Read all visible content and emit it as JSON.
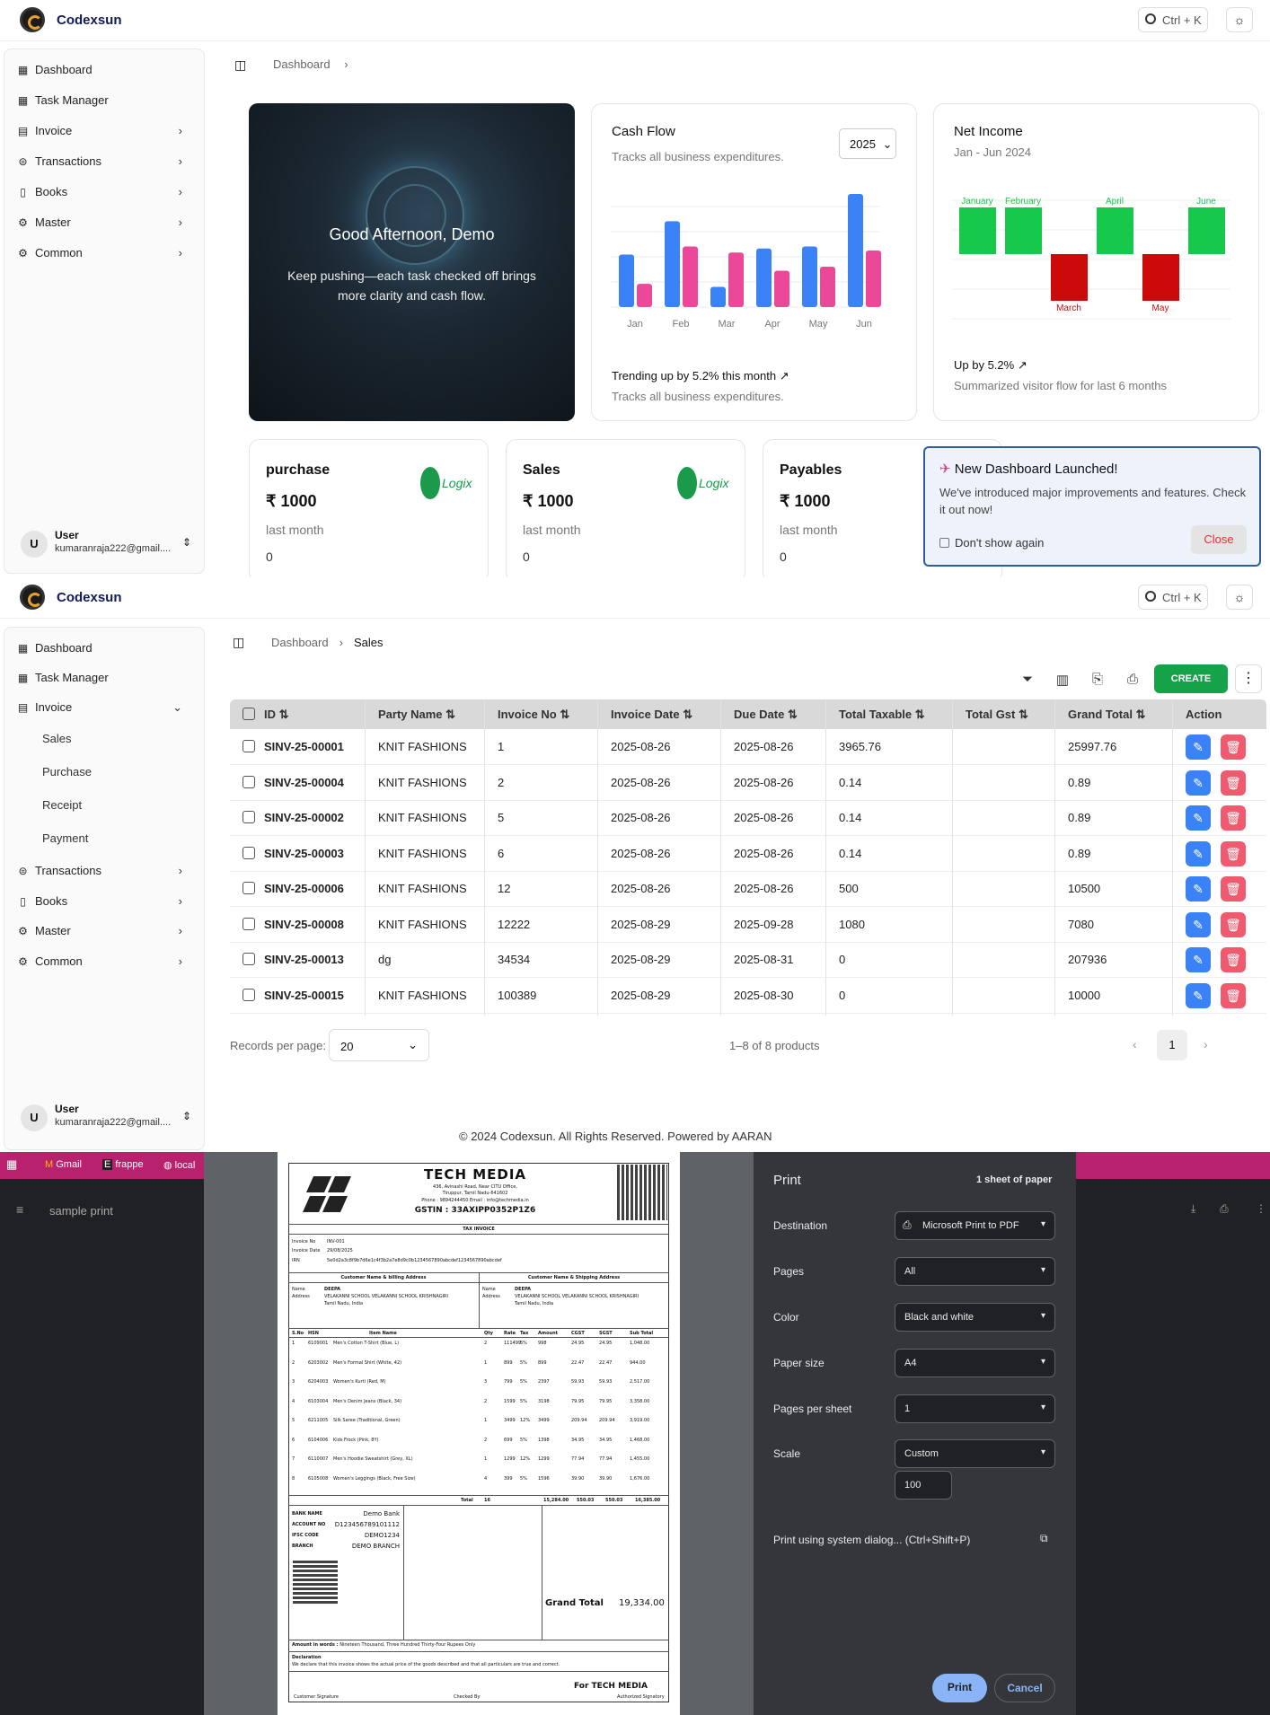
{
  "app": {
    "brand": "Codexsun",
    "search_shortcut": "Ctrl + K"
  },
  "sidebar": {
    "items": [
      {
        "label": "Dashboard",
        "icon": "grid-icon"
      },
      {
        "label": "Task Manager",
        "icon": "grid-icon"
      },
      {
        "label": "Invoice",
        "icon": "document-icon"
      },
      {
        "label": "Transactions",
        "icon": "currency-icon"
      },
      {
        "label": "Books",
        "icon": "book-icon"
      },
      {
        "label": "Master",
        "icon": "gear-icon"
      },
      {
        "label": "Common",
        "icon": "gear-icon"
      }
    ],
    "invoice_sub": [
      "Sales",
      "Purchase",
      "Receipt",
      "Payment"
    ],
    "user": {
      "initial": "U",
      "name": "User",
      "email": "kumaranraja222@gmail...."
    }
  },
  "dashboard": {
    "breadcrumb": "Dashboard",
    "hero": {
      "greeting": "Good Afternoon, Demo",
      "message": "Keep pushing—each task checked off brings more clarity and cash flow."
    },
    "cashflow": {
      "title": "Cash Flow",
      "subtitle": "Tracks all business expenditures.",
      "year": "2025",
      "trend": "Trending up by 5.2% this month",
      "footer": "Tracks all business expenditures."
    },
    "netincome": {
      "title": "Net Income",
      "subtitle": "Jan - Jun 2024",
      "trend": "Up by 5.2%",
      "footer": "Summarized visitor flow for last 6 months"
    },
    "stats": [
      {
        "title": "purchase",
        "value": "₹ 1000",
        "label": "last month",
        "count": "0",
        "logo": "Logix"
      },
      {
        "title": "Sales",
        "value": "₹ 1000",
        "label": "last month",
        "count": "0",
        "logo": "Logix"
      },
      {
        "title": "Payables",
        "value": "₹ 1000",
        "label": "last month",
        "count": "0"
      }
    ],
    "toast": {
      "title": "New Dashboard Launched!",
      "body": "We've introduced major improvements and features. Check it out now!",
      "checkbox": "Don't show again",
      "close": "Close"
    }
  },
  "chart_data": [
    {
      "type": "bar",
      "title": "Cash Flow",
      "categories": [
        "Jan",
        "Feb",
        "Mar",
        "Apr",
        "May",
        "Jun"
      ],
      "series": [
        {
          "values": [
            52,
            85,
            20,
            58,
            60,
            112
          ]
        },
        {
          "values": [
            23,
            60,
            54,
            36,
            40,
            56
          ]
        }
      ],
      "colors": [
        "#3b82f6",
        "#ec4899"
      ],
      "ylim": [
        0,
        120
      ]
    },
    {
      "type": "bar",
      "title": "Net Income",
      "categories": [
        "January",
        "February",
        "April",
        "June",
        "March",
        "May"
      ],
      "bars": [
        {
          "label": "January",
          "value": 1
        },
        {
          "label": "February",
          "value": 1
        },
        {
          "label": "March",
          "value": -1
        },
        {
          "label": "April",
          "value": 1
        },
        {
          "label": "May",
          "value": -1
        },
        {
          "label": "June",
          "value": 1
        }
      ],
      "colors": {
        "positive": "#16c94a",
        "negative": "#cc0a0a"
      }
    }
  ],
  "sales": {
    "breadcrumb": [
      "Dashboard",
      "Sales"
    ],
    "create": "CREATE",
    "columns": [
      "ID",
      "Party Name",
      "Invoice No",
      "Invoice Date",
      "Due Date",
      "Total Taxable",
      "Total Gst",
      "Grand Total",
      "Action"
    ],
    "rows": [
      [
        "SINV-25-00001",
        "KNIT FASHIONS",
        "1",
        "2025-08-26",
        "2025-08-26",
        "3965.76",
        "",
        "25997.76"
      ],
      [
        "SINV-25-00004",
        "KNIT FASHIONS",
        "2",
        "2025-08-26",
        "2025-08-26",
        "0.14",
        "",
        "0.89"
      ],
      [
        "SINV-25-00002",
        "KNIT FASHIONS",
        "5",
        "2025-08-26",
        "2025-08-26",
        "0.14",
        "",
        "0.89"
      ],
      [
        "SINV-25-00003",
        "KNIT FASHIONS",
        "6",
        "2025-08-26",
        "2025-08-26",
        "0.14",
        "",
        "0.89"
      ],
      [
        "SINV-25-00006",
        "KNIT FASHIONS",
        "12",
        "2025-08-26",
        "2025-08-26",
        "500",
        "",
        "10500"
      ],
      [
        "SINV-25-00008",
        "KNIT FASHIONS",
        "12222",
        "2025-08-29",
        "2025-09-28",
        "1080",
        "",
        "7080"
      ],
      [
        "SINV-25-00013",
        "dg",
        "34534",
        "2025-08-29",
        "2025-08-31",
        "0",
        "",
        "207936"
      ],
      [
        "SINV-25-00015",
        "KNIT FASHIONS",
        "100389",
        "2025-08-29",
        "2025-08-30",
        "0",
        "",
        "10000"
      ]
    ],
    "records_label": "Records per page:",
    "records_value": "20",
    "summary": "1–8 of 8 products",
    "page": "1",
    "footer": "© 2024 Codexsun. All Rights Reserved. Powered by AARAN"
  },
  "browser": {
    "bookmarks": [
      "Gmail",
      "frappe",
      "local"
    ],
    "tab_title": "sample print"
  },
  "invoice": {
    "company": "TECH MEDIA",
    "address": "436, Avinashi Road, Near CITU Office,",
    "city": "Tiruppur, Tamil Nadu-641602",
    "contact": "Phone : 9894244450 Email : info@techmedia.in",
    "gstin": "GSTIN : 33AXIPP0352P1Z6",
    "doc_title": "TAX INVOICE",
    "invoice_no": "INV-001",
    "invoice_date": "29/08/2025",
    "irn": "5e0d2a3c8f9b7d6e1c4f3b2a7e8d9c0b1234567890abcdef1234567890abcdef",
    "billing_header": "Customer Name & billing Address",
    "shipping_header": "Customer Name & Shipping Address",
    "customer": "DEEPA",
    "cust_address": "VELAKANNI SCHOOL VELAKANNI SCHOOL KRISHNAGIRI",
    "cust_state": "Tamil Nadu, India",
    "item_headers": [
      "S.No",
      "HSN",
      "Item Name",
      "Qty",
      "Rate",
      "Tax",
      "Amount",
      "CGST",
      "SGST",
      "Sub Total"
    ],
    "items": [
      [
        "1",
        "6109001",
        "Men's Cotton T-Shirt (Blue, L)",
        "2",
        "111499",
        "5%",
        "998",
        "24.95",
        "24.95",
        "1,048.00"
      ],
      [
        "2",
        "6203002",
        "Men's Formal Shirt (White, 42)",
        "1",
        "899",
        "5%",
        "899",
        "22.47",
        "22.47",
        "944.00"
      ],
      [
        "3",
        "6204003",
        "Women's Kurti (Red, M)",
        "3",
        "799",
        "5%",
        "2397",
        "59.93",
        "59.93",
        "2,517.00"
      ],
      [
        "4",
        "6103004",
        "Men's Denim Jeans (Black, 34)",
        "2",
        "1599",
        "5%",
        "3198",
        "79.95",
        "79.95",
        "3,358.00"
      ],
      [
        "5",
        "6211005",
        "Silk Saree (Traditional, Green)",
        "1",
        "3499",
        "12%",
        "3499",
        "209.94",
        "209.94",
        "3,919.00"
      ],
      [
        "6",
        "6104006",
        "Kids Frock (Pink, 8Y)",
        "2",
        "699",
        "5%",
        "1398",
        "34.95",
        "34.95",
        "1,468.00"
      ],
      [
        "7",
        "6110007",
        "Men's Hoodie Sweatshirt (Grey, XL)",
        "1",
        "1299",
        "12%",
        "1299",
        "77.94",
        "77.94",
        "1,455.00"
      ],
      [
        "8",
        "6105008",
        "Women's Leggings (Black, Free Size)",
        "4",
        "399",
        "5%",
        "1596",
        "39.90",
        "39.90",
        "1,676.00"
      ]
    ],
    "total_qty": "16",
    "total_amount": "15,284.00",
    "total_cgst": "550.03",
    "total_sgst": "550.03",
    "total_sub": "16,385.00",
    "bank_name": "Demo Bank",
    "account_no": "D123456789101112",
    "ifsc": "DEMO1234",
    "branch": "DEMO BRANCH",
    "grand_total_label": "Grand Total",
    "grand_total": "19,334.00",
    "words": "Nineteen Thousand, Three Hundred Thirty-Four Rupees Only",
    "declaration": "We declare that this invoice shows the actual price of the goods described and that all particulars are true and correct.",
    "for_label": "For TECH MEDIA",
    "signatures": [
      "Customer Signature",
      "Checked By",
      "Authorized Signatory"
    ]
  },
  "print": {
    "title": "Print",
    "sheets": "1 sheet of paper",
    "fields": [
      {
        "label": "Destination",
        "value": "Microsoft Print to PDF"
      },
      {
        "label": "Pages",
        "value": "All"
      },
      {
        "label": "Color",
        "value": "Black and white"
      },
      {
        "label": "Paper size",
        "value": "A4"
      },
      {
        "label": "Pages per sheet",
        "value": "1"
      },
      {
        "label": "Scale",
        "value": "Custom"
      }
    ],
    "scale_value": "100",
    "system_dialog": "Print using system dialog... (Ctrl+Shift+P)",
    "print_btn": "Print",
    "cancel_btn": "Cancel"
  }
}
